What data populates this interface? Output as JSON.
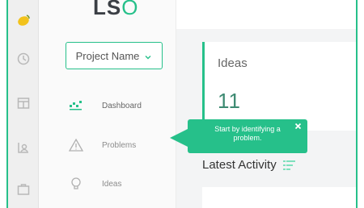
{
  "brand": {
    "logo_prefix": "LS",
    "logo_suffix": "O"
  },
  "project_select": {
    "value": "Project Name"
  },
  "sidebar": {
    "items": [
      {
        "label": "Dashboard",
        "icon": "dashboard-icon"
      },
      {
        "label": "Problems",
        "icon": "warning-icon"
      },
      {
        "label": "Ideas",
        "icon": "lightbulb-icon"
      }
    ]
  },
  "cards": {
    "ideas": {
      "title": "Ideas",
      "value": "11"
    }
  },
  "activity": {
    "title": "Latest Activity"
  },
  "tooltip": {
    "text": "Start by identifying a problem."
  },
  "colors": {
    "accent": "#26c08a",
    "logo_badge": "#f2c21b"
  }
}
